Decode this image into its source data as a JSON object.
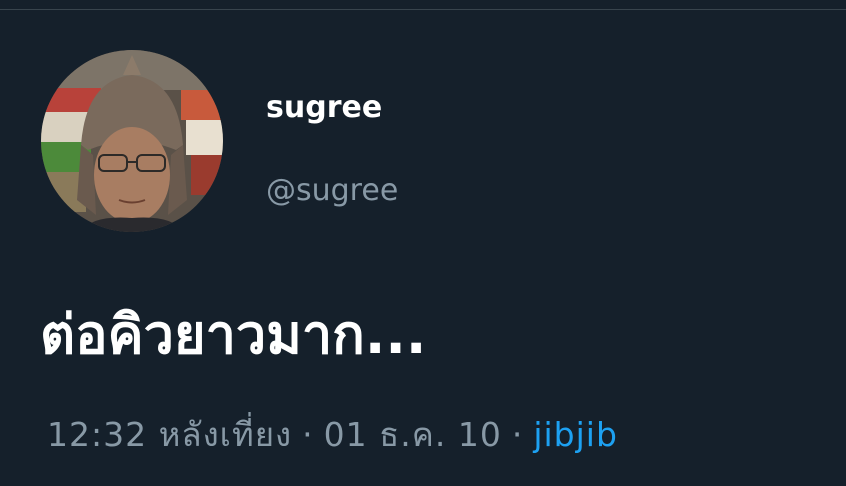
{
  "author": {
    "display_name": "sugree",
    "handle": "@sugree"
  },
  "tweet": {
    "text": "ต่อคิวยาวมาก...",
    "time": "12:32 หลังเที่ยง",
    "separator": "·",
    "date": "01 ธ.ค. 10",
    "source": "jibjib"
  },
  "colors": {
    "background": "#15202b",
    "text_primary": "#ffffff",
    "text_secondary": "#8899a6",
    "link": "#1da1f2"
  }
}
